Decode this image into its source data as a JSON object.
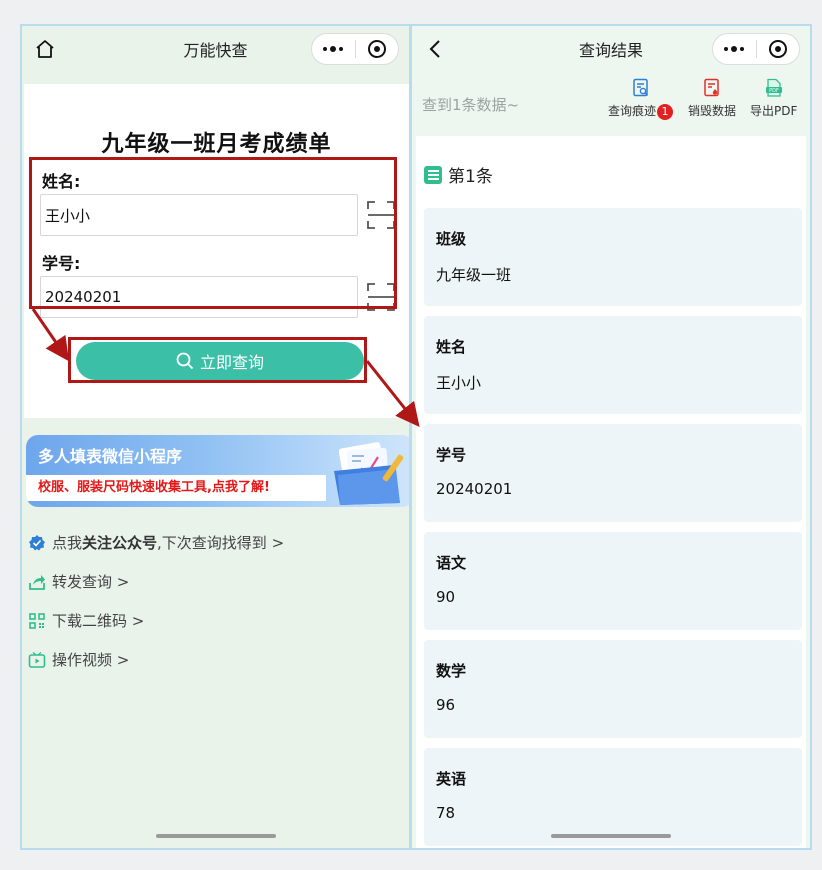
{
  "left": {
    "nav_title": "万能快查",
    "form_title": "九年级一班月考成绩单",
    "name_label": "姓名:",
    "name_value": "王小小",
    "id_label": "学号:",
    "id_value": "20240201",
    "query_button": "立即查询",
    "banner_title": "多人填表微信小程序",
    "banner_sub": "校服、服装尺码快速收集工具,点我了解!",
    "links": [
      {
        "icon": "verified-icon",
        "pre": "点我",
        "bold": "关注公众号",
        "post": ",下次查询找得到 >"
      },
      {
        "icon": "share-icon",
        "text": "转发查询 >"
      },
      {
        "icon": "qrcode-icon",
        "text": "下载二维码 >"
      },
      {
        "icon": "video-icon",
        "text": "操作视频 >"
      }
    ]
  },
  "right": {
    "nav_title": "查询结果",
    "result_count": "查到1条数据~",
    "tools": [
      {
        "icon": "search-trace-icon",
        "label": "查询痕迹",
        "badge": "1",
        "color": "#2f7fd6"
      },
      {
        "icon": "destroy-data-icon",
        "label": "销毁数据",
        "color": "#e0302a"
      },
      {
        "icon": "pdf-icon",
        "label": "导出PDF",
        "color": "#2fbf8f"
      }
    ],
    "record_title": "第1条",
    "fields": [
      {
        "label": "班级",
        "value": "九年级一班"
      },
      {
        "label": "姓名",
        "value": "王小小"
      },
      {
        "label": "学号",
        "value": "20240201"
      },
      {
        "label": "语文",
        "value": "90"
      },
      {
        "label": "数学",
        "value": "96"
      },
      {
        "label": "英语",
        "value": "78"
      }
    ]
  },
  "colors": {
    "accent": "#3bbfa7",
    "highlight": "#b01717",
    "page_bg_left": "#e9f3ea",
    "page_bg_right": "#eef7ef"
  }
}
